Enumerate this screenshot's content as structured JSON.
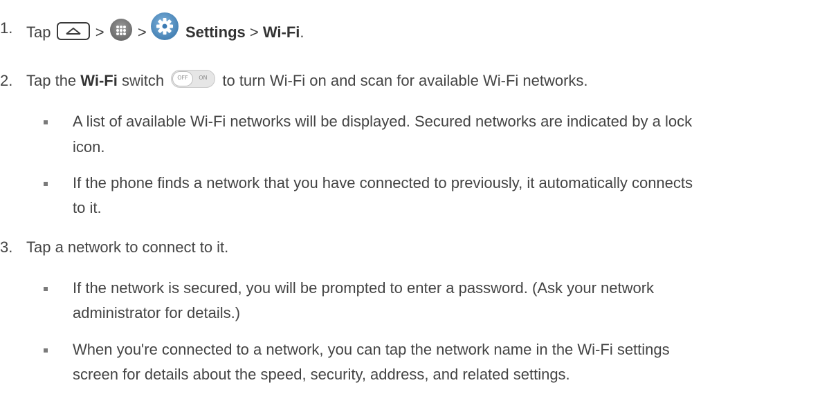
{
  "steps": [
    {
      "number": "1.",
      "parts": {
        "tap": "Tap",
        "sep1": ">",
        "sep2": ">",
        "settings": "Settings",
        "sep3": ">",
        "wifi": "Wi-Fi",
        "end": "."
      }
    },
    {
      "number": "2.",
      "parts": {
        "tap_the": "Tap the",
        "wifi": "Wi-Fi",
        "switch": "switch",
        "rest": "to turn Wi-Fi on and scan for available Wi-Fi networks.",
        "toggle_off": "OFF",
        "toggle_on": "ON"
      },
      "bullets": [
        {
          "line1": "A list of available Wi-Fi networks will be displayed. Secured networks are indicated by a lock",
          "line2": "icon."
        },
        {
          "line1": "If the phone finds a network that you have connected to previously, it automatically connects",
          "line2": "to it."
        }
      ]
    },
    {
      "number": "3.",
      "text": "Tap a network to connect to it.",
      "bullets": [
        {
          "line1": "If the network is secured, you will be prompted to enter a password. (Ask your network",
          "line2": "administrator for details.)"
        },
        {
          "line1": "When you're connected to a network, you can tap the network name in the Wi-Fi settings",
          "line2": "screen for details about the speed, security, address, and related settings."
        }
      ]
    }
  ],
  "icons": {
    "home": "home-icon",
    "apps": "apps-icon",
    "settings": "settings-gear-icon",
    "toggle": "wifi-toggle-switch"
  }
}
